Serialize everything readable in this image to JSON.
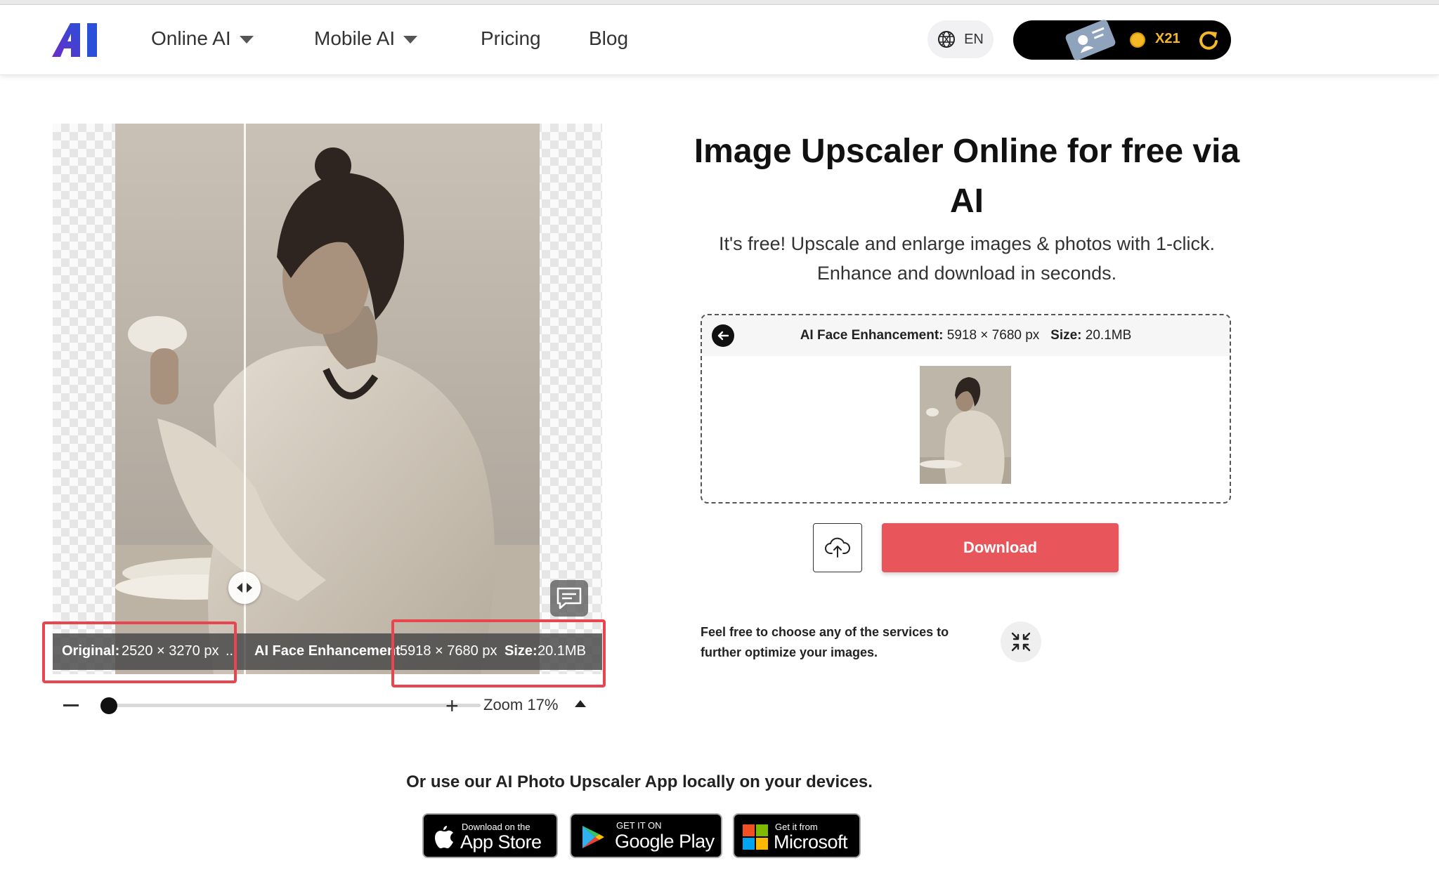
{
  "nav": {
    "items": [
      {
        "label": "Online AI",
        "has_dropdown": true
      },
      {
        "label": "Mobile AI",
        "has_dropdown": true
      },
      {
        "label": "Pricing"
      },
      {
        "label": "Blog"
      }
    ],
    "language": "EN",
    "credits": "X21"
  },
  "viewer": {
    "original_label": "Original:",
    "original_dims": "2520 × 3270 px",
    "ellipsis": "..",
    "enhanced_label": "AI Face Enhancement",
    "enhanced_dims": "5918 × 7680 px",
    "size_label": "Size:",
    "size_value": "20.1MB",
    "zoom_label": "Zoom 17%",
    "zoom_fraction": 0.17
  },
  "hero": {
    "title": "Image Upscaler Online for free via AI",
    "subtitle": "It's free! Upscale and enlarge images & photos with 1-click. Enhance and download in seconds."
  },
  "result": {
    "mode_label": "AI Face Enhancement:",
    "dims": "5918 × 7680 px",
    "size_label": "Size:",
    "size_value": "20.1MB",
    "download_label": "Download",
    "services_text": "Feel free to choose any of the services to further optimize your images."
  },
  "apps": {
    "line": "Or use our AI Photo Upscaler App locally on your devices.",
    "appstore_small": "Download on the",
    "appstore_big": "App Store",
    "googleplay_small": "GET IT ON",
    "googleplay_big": "Google Play",
    "microsoft_small": "Get it from",
    "microsoft_big": "Microsoft"
  },
  "colors": {
    "accent_red": "#e8555a",
    "highlight_red": "#e8454f",
    "credit_gold": "#f5b826"
  }
}
